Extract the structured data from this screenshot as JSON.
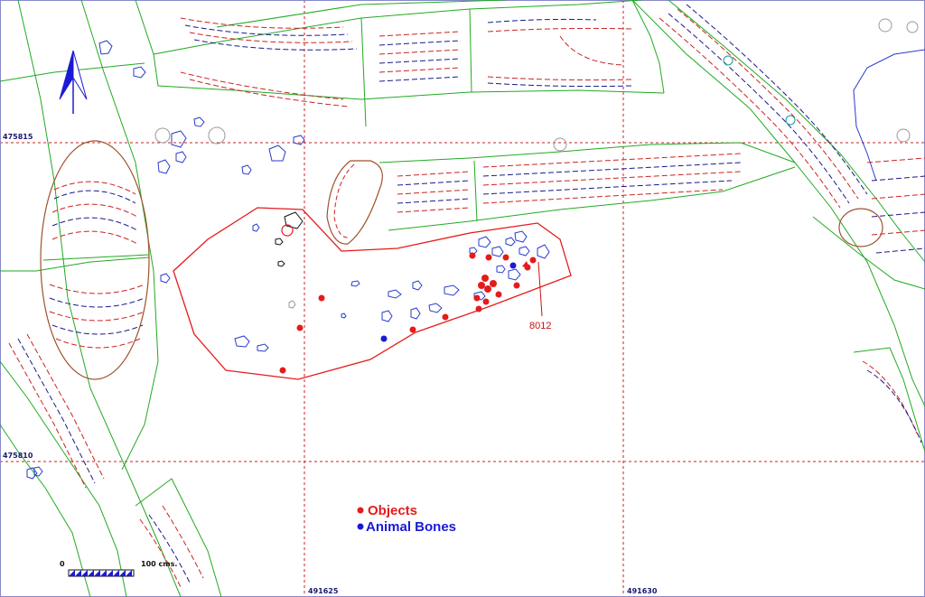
{
  "grid": {
    "easting_labels": [
      "491625",
      "491630"
    ],
    "northing_labels": [
      "475815",
      "475810"
    ]
  },
  "feature": {
    "label": "8012"
  },
  "legend": {
    "items": [
      {
        "label": "Objects",
        "color": "#e51b1b"
      },
      {
        "label": "Animal Bones",
        "color": "#1a1ad6"
      }
    ]
  },
  "scale_bar": {
    "start_label": "0",
    "end_label": "100 cms."
  },
  "north_arrow": {
    "icon": "north-arrow-icon"
  },
  "colors": {
    "grid": "#cc2222",
    "boundary": "#e51b1b",
    "outline_green": "#22aa22",
    "stones_blue": "#2a3bcc",
    "contour_red": "#cc2222",
    "contour_blue": "#1a1a8a",
    "pit_brown": "#a0522d"
  }
}
